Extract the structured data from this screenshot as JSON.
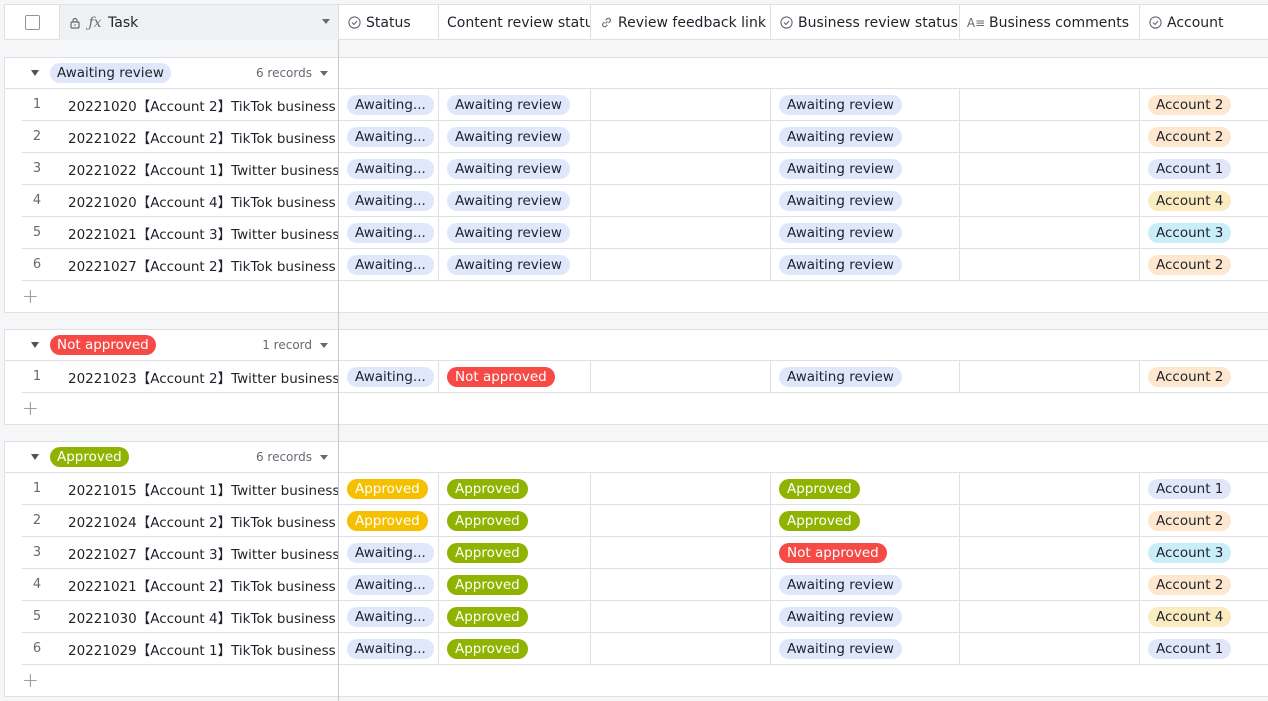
{
  "header": {
    "task_label": "Task",
    "columns": [
      {
        "label": "Status",
        "icon": "circle-check-icon"
      },
      {
        "label": "Content review status",
        "icon": ""
      },
      {
        "label": "Review feedback link",
        "icon": "link-icon"
      },
      {
        "label": "Business review status",
        "icon": "circle-check-icon"
      },
      {
        "label": "Business comments",
        "icon": "text-icon"
      },
      {
        "label": "Account",
        "icon": "circle-check-icon"
      }
    ]
  },
  "groups": [
    {
      "label": "Awaiting review",
      "count": "6 records",
      "rows": [
        {
          "n": "1",
          "task": "20221020【Account 2】TikTok business",
          "status": "Awaiting...",
          "content": "Awaiting review",
          "business": "Awaiting review",
          "account": "Account 2"
        },
        {
          "n": "2",
          "task": "20221022【Account 2】TikTok business",
          "status": "Awaiting...",
          "content": "Awaiting review",
          "business": "Awaiting review",
          "account": "Account 2"
        },
        {
          "n": "3",
          "task": "20221022【Account 1】Twitter business",
          "status": "Awaiting...",
          "content": "Awaiting review",
          "business": "Awaiting review",
          "account": "Account 1"
        },
        {
          "n": "4",
          "task": "20221020【Account 4】TikTok business",
          "status": "Awaiting...",
          "content": "Awaiting review",
          "business": "Awaiting review",
          "account": "Account 4"
        },
        {
          "n": "5",
          "task": "20221021【Account 3】Twitter business",
          "status": "Awaiting...",
          "content": "Awaiting review",
          "business": "Awaiting review",
          "account": "Account 3"
        },
        {
          "n": "6",
          "task": "20221027【Account 2】TikTok business",
          "status": "Awaiting...",
          "content": "Awaiting review",
          "business": "Awaiting review",
          "account": "Account 2"
        }
      ]
    },
    {
      "label": "Not approved",
      "count": "1 record",
      "rows": [
        {
          "n": "1",
          "task": "20221023【Account 2】Twitter business",
          "status": "Awaiting...",
          "content": "Not approved",
          "business": "Awaiting review",
          "account": "Account 2"
        }
      ]
    },
    {
      "label": "Approved",
      "count": "6 records",
      "rows": [
        {
          "n": "1",
          "task": "20221015【Account 1】Twitter business",
          "status": "Approved",
          "content": "Approved",
          "business": "Approved",
          "account": "Account 1"
        },
        {
          "n": "2",
          "task": "20221024【Account 2】TikTok business",
          "status": "Approved",
          "content": "Approved",
          "business": "Approved",
          "account": "Account 2"
        },
        {
          "n": "3",
          "task": "20221027【Account 3】Twitter business",
          "status": "Awaiting...",
          "content": "Approved",
          "business": "Not approved",
          "account": "Account 3"
        },
        {
          "n": "4",
          "task": "20221021【Account 2】TikTok business",
          "status": "Awaiting...",
          "content": "Approved",
          "business": "Awaiting review",
          "account": "Account 2"
        },
        {
          "n": "5",
          "task": "20221030【Account 4】TikTok business",
          "status": "Awaiting...",
          "content": "Approved",
          "business": "Awaiting review",
          "account": "Account 4"
        },
        {
          "n": "6",
          "task": "20221029【Account 1】TikTok business",
          "status": "Awaiting...",
          "content": "Approved",
          "business": "Awaiting review",
          "account": "Account 1"
        }
      ]
    }
  ],
  "colors": {
    "awaiting": "#e1e7fa",
    "not_approved": "#f54a45",
    "approved_green": "#8fb300",
    "approved_yellow": "#f5c000",
    "account_1": "#e1e7fa",
    "account_2": "#fde7cf",
    "account_3": "#c9eefa",
    "account_4": "#faecc0"
  }
}
